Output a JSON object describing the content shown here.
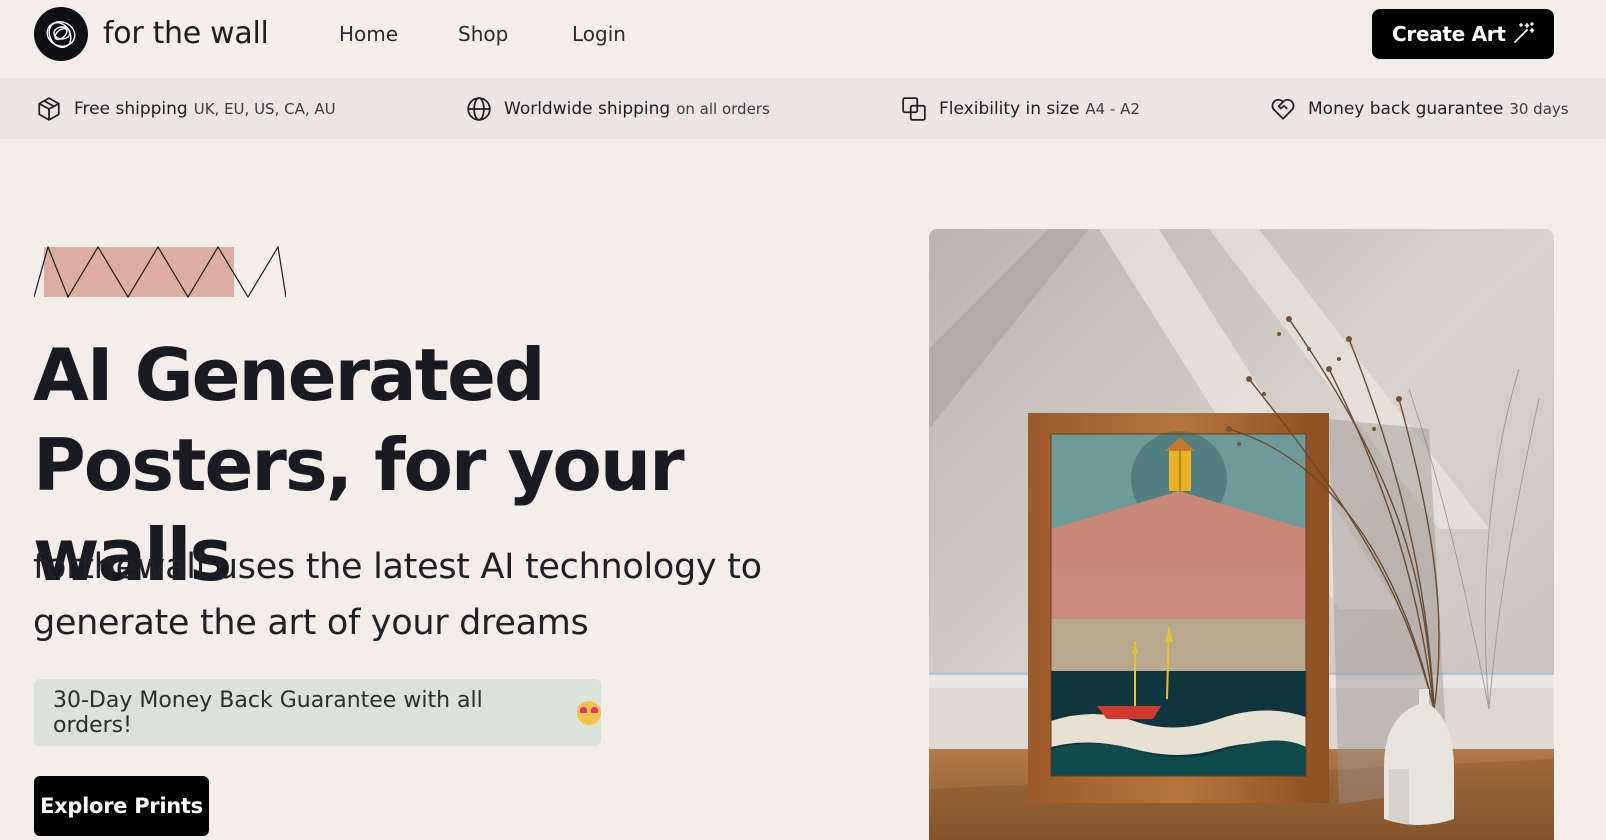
{
  "header": {
    "brand": "for the wall",
    "nav": [
      "Home",
      "Shop",
      "Login"
    ],
    "cta_label": "Create Art"
  },
  "features": [
    {
      "icon": "box-icon",
      "title": "Free shipping",
      "sub": "UK, EU, US, CA, AU"
    },
    {
      "icon": "globe-icon",
      "title": "Worldwide shipping",
      "sub": "on all orders"
    },
    {
      "icon": "resize-icon",
      "title": "Flexibility in size",
      "sub": "A4 - A2"
    },
    {
      "icon": "heart-handshake-icon",
      "title": "Money back guarantee",
      "sub": "30 days"
    }
  ],
  "hero": {
    "title": "AI Generated Posters, for your walls",
    "subtitle": "forthewall uses the latest AI technology to generate the art of your dreams",
    "guarantee": "30-Day Money Back Guarantee with all orders!",
    "guarantee_emoji": "star-struck-emoji",
    "button_label": "Explore Prints"
  },
  "colors": {
    "background": "#f4eeeb",
    "feature_bar": "#ebe6e3",
    "accent_pink": "#dcaea2",
    "guarantee_bg": "#dbe2d9",
    "button": "#000000"
  }
}
